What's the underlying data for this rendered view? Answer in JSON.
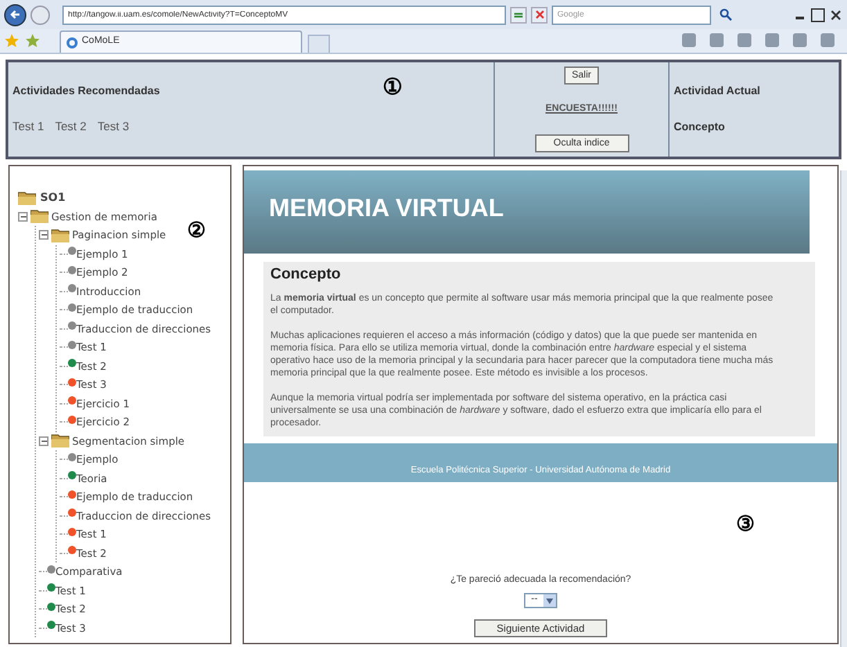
{
  "browser": {
    "url": "http://tangow.ii.uam.es/comole/NewActivity?T=ConceptoMV",
    "search_placeholder": "Google",
    "tab": "CoMoLE"
  },
  "top_panel": {
    "recommended_title": "Actividades Recomendadas",
    "recommended": [
      "Test 1",
      "Test 2",
      "Test 3"
    ],
    "marker": "①",
    "exit_button": "Salir",
    "survey_link": "ENCUESTA!!!!!!",
    "hide_index_button": "Oculta indice",
    "current_title": "Actividad Actual",
    "current": "Concepto"
  },
  "tree": {
    "marker": "②",
    "root": {
      "label": "SO1",
      "children": [
        {
          "label": "Gestion de memoria",
          "children": [
            {
              "label": "Paginacion simple",
              "children": [
                {
                  "label": "Ejemplo 1",
                  "color": "#8a8a8a"
                },
                {
                  "label": "Ejemplo 2",
                  "color": "#8a8a8a"
                },
                {
                  "label": "Introduccion",
                  "color": "#8a8a8a"
                },
                {
                  "label": "Ejemplo de traduccion",
                  "color": "#8a8a8a"
                },
                {
                  "label": "Traduccion de direcciones",
                  "color": "#8a8a8a"
                },
                {
                  "label": "Test 1",
                  "color": "#8a8a8a"
                },
                {
                  "label": "Test 2",
                  "color": "#1f8a4c"
                },
                {
                  "label": "Test 3",
                  "color": "#f0522a"
                },
                {
                  "label": "Ejercicio 1",
                  "color": "#f0522a"
                },
                {
                  "label": "Ejercicio 2",
                  "color": "#f0522a"
                }
              ]
            },
            {
              "label": "Segmentacion simple",
              "children": [
                {
                  "label": "Ejemplo",
                  "color": "#8a8a8a"
                },
                {
                  "label": "Teoria",
                  "color": "#1f8a4c"
                },
                {
                  "label": "Ejemplo de traduccion",
                  "color": "#f0522a"
                },
                {
                  "label": "Traduccion de direcciones",
                  "color": "#f0522a"
                },
                {
                  "label": "Test 1",
                  "color": "#f0522a"
                },
                {
                  "label": "Test 2",
                  "color": "#f0522a"
                }
              ]
            },
            {
              "label": "Comparativa",
              "color": "#8a8a8a"
            },
            {
              "label": "Test 1",
              "color": "#1f8a4c"
            },
            {
              "label": "Test 2",
              "color": "#1f8a4c"
            },
            {
              "label": "Test 3",
              "color": "#1f8a4c"
            }
          ]
        }
      ]
    }
  },
  "content": {
    "title": "MEMORIA VIRTUAL",
    "heading": "Concepto",
    "paragraphs": [
      "La **memoria virtual** es un concepto que permite al software usar más memoria principal que la que realmente posee el computador.",
      "Muchas aplicaciones requieren el acceso a más información (código y datos) que la que puede ser mantenida en memoria física. Para ello se utiliza memoria virtual, donde la combinación entre *hardware* especial y el sistema operativo hace uso de la memoria principal y la secundaria para hacer parecer que la computadora tiene mucha más memoria principal que la que realmente posee. Este método es invisible a los procesos.",
      "Aunque la memoria virtual podría ser implementada por software del sistema operativo, en la práctica casi universalmente se usa una combinación de *hardware* y software, dado el esfuerzo extra que implicaría ello para el procesador."
    ],
    "footer": "Escuela Politécnica Superior - Universidad Autónoma de Madrid"
  },
  "feedback": {
    "question": "¿Te pareció adecuada la recomendación?",
    "select_value": "--",
    "marker": "③",
    "next_button": "Siguiente Actividad"
  }
}
